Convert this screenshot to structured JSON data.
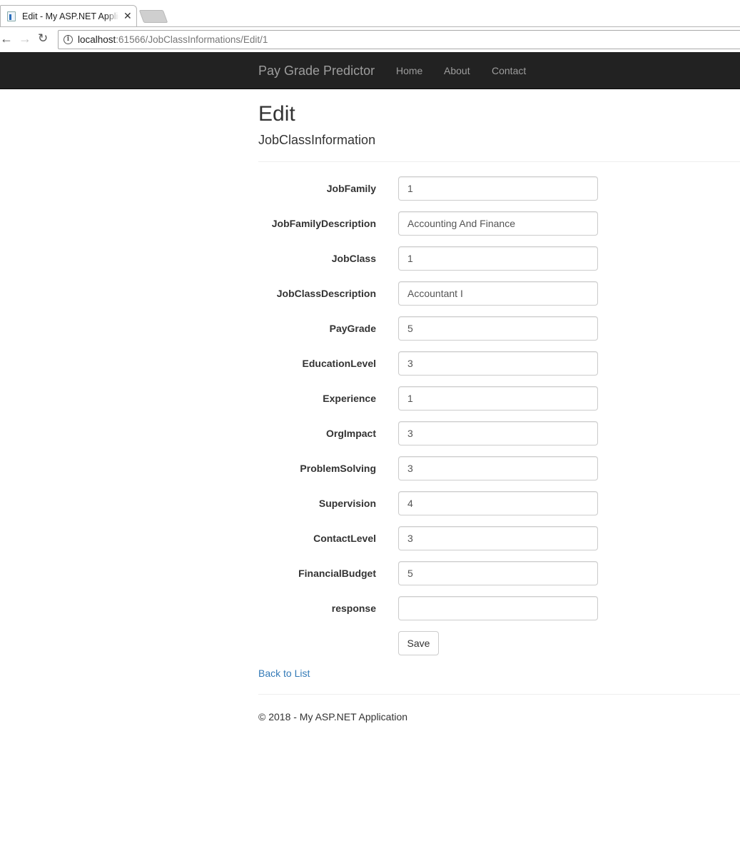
{
  "browser": {
    "tab_title": "Edit - My ASP.NET Applic",
    "url_host": "localhost",
    "url_rest": ":61566/JobClassInformations/Edit/1"
  },
  "navbar": {
    "brand": "Pay Grade Predictor",
    "links": [
      "Home",
      "About",
      "Contact"
    ]
  },
  "page": {
    "title": "Edit",
    "subtitle": "JobClassInformation"
  },
  "form": {
    "fields": [
      {
        "label": "JobFamily",
        "value": "1"
      },
      {
        "label": "JobFamilyDescription",
        "value": "Accounting And Finance"
      },
      {
        "label": "JobClass",
        "value": "1"
      },
      {
        "label": "JobClassDescription",
        "value": "Accountant I"
      },
      {
        "label": "PayGrade",
        "value": "5"
      },
      {
        "label": "EducationLevel",
        "value": "3"
      },
      {
        "label": "Experience",
        "value": "1"
      },
      {
        "label": "OrgImpact",
        "value": "3"
      },
      {
        "label": "ProblemSolving",
        "value": "3"
      },
      {
        "label": "Supervision",
        "value": "4"
      },
      {
        "label": "ContactLevel",
        "value": "3"
      },
      {
        "label": "FinancialBudget",
        "value": "5"
      },
      {
        "label": "response",
        "value": ""
      }
    ],
    "save_label": "Save"
  },
  "back_link": "Back to List",
  "footer": "© 2018 - My ASP.NET Application",
  "colors": {
    "navbar_bg": "#222222",
    "navbar_text": "#9d9d9d",
    "link": "#337ab7"
  }
}
